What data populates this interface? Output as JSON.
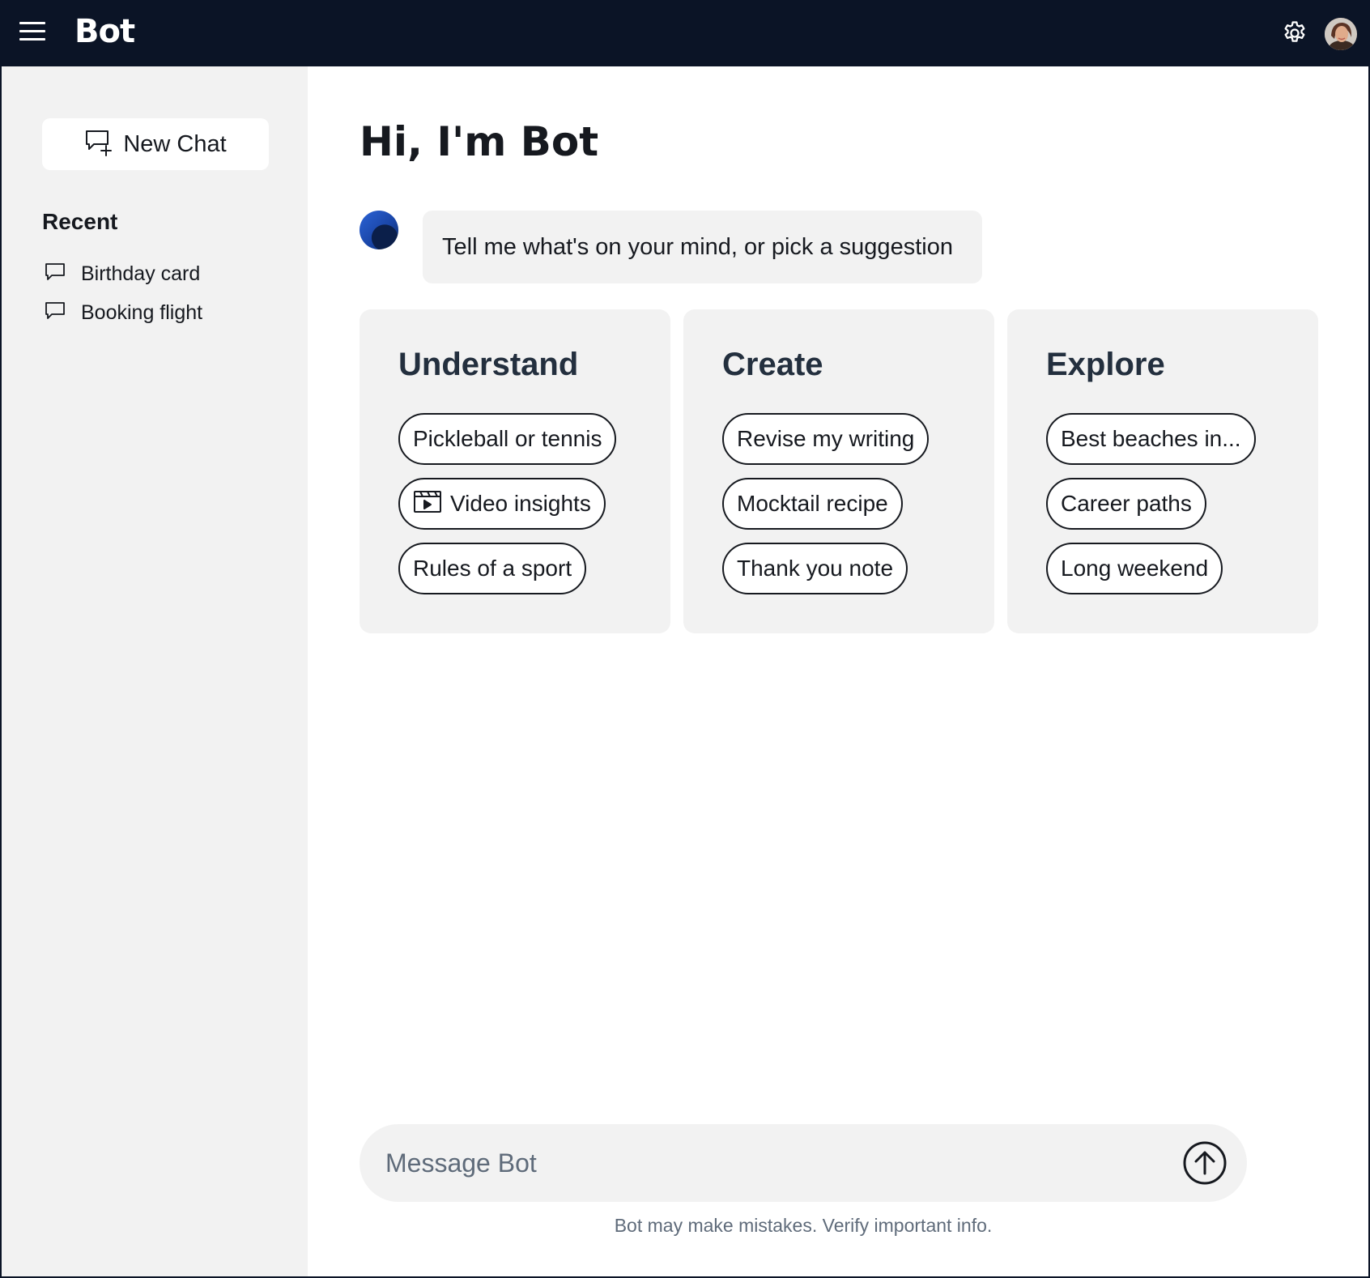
{
  "app": {
    "brand": "Bot"
  },
  "icons": {
    "menu": "hamburger-menu-icon",
    "settings": "gear-icon",
    "avatar": "user-avatar",
    "new_chat": "chat-plus-icon",
    "recent_item": "chat-bubble-icon",
    "video": "video-clip-icon",
    "send": "arrow-up-circle-icon"
  },
  "sidebar": {
    "new_chat_label": "New Chat",
    "recent_heading": "Recent",
    "recent": [
      {
        "label": "Birthday card"
      },
      {
        "label": "Booking flight"
      }
    ]
  },
  "main": {
    "greeting": "Hi, I'm Bot",
    "intro_message": "Tell me what's on your mind, or pick a suggestion",
    "cards": [
      {
        "title": "Understand",
        "chips": [
          "Pickleball or tennis",
          "Video insights",
          "Rules of a sport"
        ]
      },
      {
        "title": "Create",
        "chips": [
          "Revise my writing",
          "Mocktail recipe",
          "Thank you note"
        ]
      },
      {
        "title": "Explore",
        "chips": [
          "Best beaches in...",
          "Career paths",
          "Long weekend"
        ]
      }
    ],
    "composer": {
      "placeholder": "Message Bot",
      "value": ""
    },
    "disclaimer": "Bot may make mistakes. Verify important info."
  },
  "colors": {
    "topbar": "#0b1426",
    "sidebar": "#f2f2f2",
    "card": "#f2f2f2",
    "text": "#16191f",
    "muted": "#5f6b7a"
  }
}
